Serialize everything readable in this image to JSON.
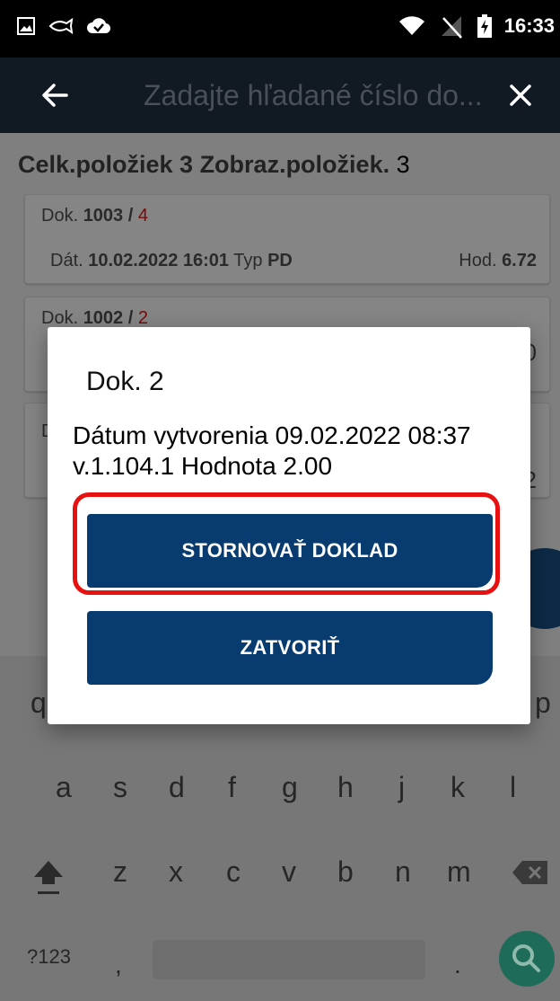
{
  "status_bar": {
    "time": "16:33",
    "icons": [
      "image-icon",
      "fish-icon",
      "cloud-check-icon",
      "wifi-icon",
      "no-signal-icon",
      "battery-charging-icon"
    ]
  },
  "app_bar": {
    "search_placeholder": "Zadajte hľadané číslo do...",
    "icons": [
      "arrow-back-icon",
      "close-icon"
    ]
  },
  "list": {
    "total_label": "Celk.položiek 3 Zobraz.položiek.",
    "total_count": "3",
    "cards": [
      {
        "doc_label": "Dok.",
        "doc_number": "1003 /",
        "doc_suffix": "4",
        "date_label": "Dát.",
        "date_value": "10.02.2022 16:01",
        "type_label": "Typ",
        "type_value": "PD",
        "value_label": "Hod.",
        "value": "6.72"
      },
      {
        "doc_label": "Dok.",
        "doc_number": "1002 /",
        "doc_suffix": "2",
        "value_suffix": "0"
      },
      {
        "doc_label": "D",
        "value_suffix": "2"
      }
    ]
  },
  "dialog": {
    "title": "Dok. 2",
    "message": "Dátum vytvorenia 09.02.2022 08:37 v.1.104.1 Hodnota 2.00",
    "storno_label": "STORNOVAŤ DOKLAD",
    "close_label": "ZATVORIŤ",
    "highlight_color": "#e81111",
    "button_color": "#083c70"
  },
  "keyboard": {
    "row1_visible": [
      "q",
      "p"
    ],
    "row2": [
      "a",
      "s",
      "d",
      "f",
      "g",
      "h",
      "j",
      "k",
      "l"
    ],
    "row3": [
      "z",
      "x",
      "c",
      "v",
      "b",
      "n",
      "m"
    ],
    "symbols_key": "?123",
    "comma_key": ",",
    "period_key": "."
  }
}
